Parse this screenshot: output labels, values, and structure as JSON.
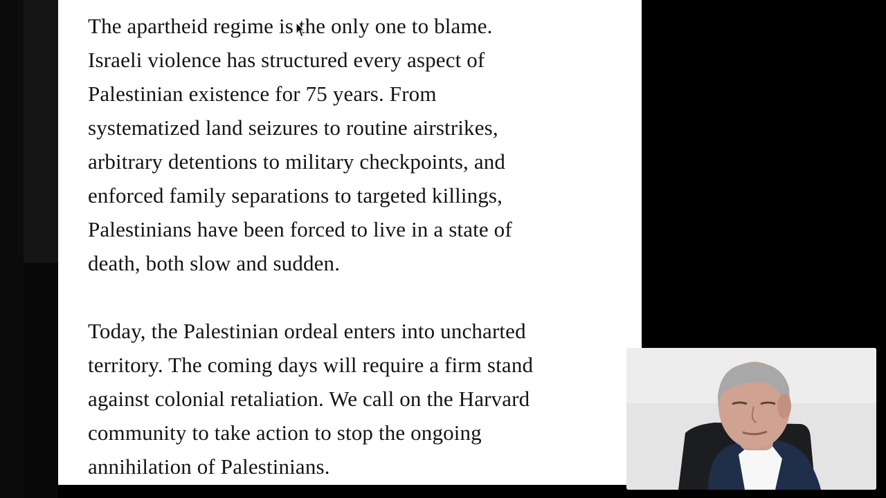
{
  "document": {
    "paragraphs": [
      "The apartheid regime is the only one to blame.\nIsraeli violence has structured every aspect of\nPalestinian existence for 75 years. From\nsystematized land seizures to routine airstrikes,\narbitrary detentions to military checkpoints, and\nenforced family separations to targeted killings,\nPalestinians have been forced to live in a state of\ndeath, both slow and sudden.",
      "Today, the Palestinian ordeal enters into uncharted\nterritory. The coming days will require a firm stand\nagainst colonial retaliation. We call on the Harvard\ncommunity to take action to stop the ongoing\nannihilation of Palestinians."
    ]
  },
  "cursor": {
    "icon": "arrow-pointer-icon"
  },
  "video_overlay": {
    "content": "webcam-video-feed"
  },
  "colors": {
    "background": "#000000",
    "page": "#ffffff",
    "text": "#141414"
  }
}
